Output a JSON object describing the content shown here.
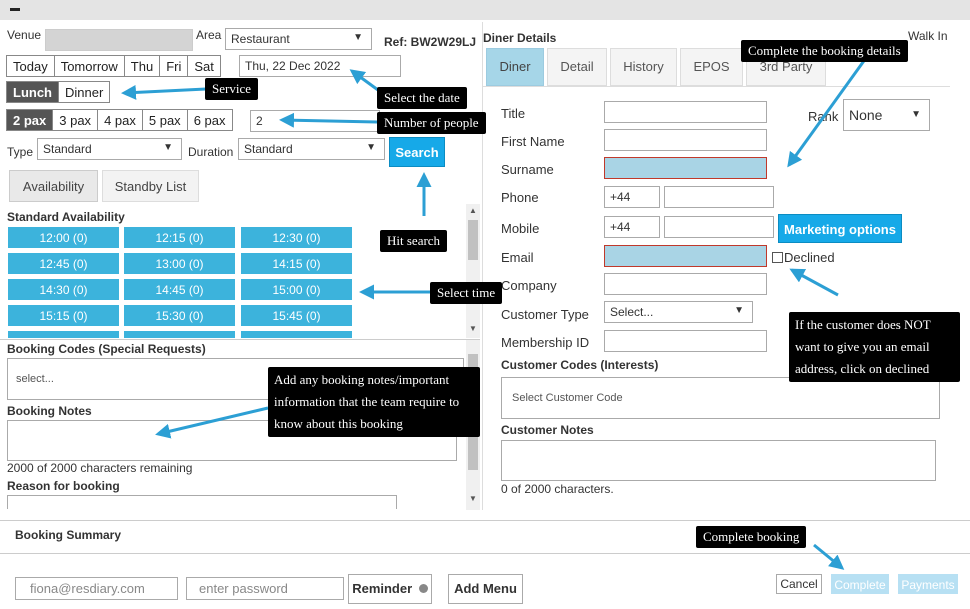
{
  "left": {
    "venue_label": "Venue",
    "area_label": "Area",
    "area_value": "Restaurant",
    "ref_label": "Ref: BW2W29LJ",
    "day_buttons": [
      "Today",
      "Tomorrow",
      "Thu",
      "Fri",
      "Sat"
    ],
    "date_value": "Thu, 22 Dec 2022",
    "service_buttons": [
      "Lunch",
      "Dinner"
    ],
    "pax_buttons": [
      "2 pax",
      "3 pax",
      "4 pax",
      "5 pax",
      "6 pax"
    ],
    "pax_value": "2",
    "type_label": "Type",
    "type_value": "Standard",
    "duration_label": "Duration",
    "duration_value": "Standard",
    "search_label": "Search",
    "tabs": [
      "Availability",
      "Standby List"
    ],
    "availability_title": "Standard Availability",
    "slots": [
      "12:00 (0)",
      "12:15 (0)",
      "12:30 (0)",
      "12:45 (0)",
      "13:00 (0)",
      "14:15 (0)",
      "14:30 (0)",
      "14:45 (0)",
      "15:00 (0)",
      "15:15 (0)",
      "15:30 (0)",
      "15:45 (0)"
    ],
    "booking_codes_title": "Booking Codes (Special Requests)",
    "booking_codes_placeholder": "select...",
    "booking_notes_title": "Booking Notes",
    "chars_remaining": "2000 of 2000 characters remaining",
    "reason_title": "Reason for booking"
  },
  "right": {
    "diner_details_title": "Diner Details",
    "walk_in": "Walk In",
    "tabs": [
      "Diner",
      "Detail",
      "History",
      "EPOS",
      "3rd Party"
    ],
    "title_label": "Title",
    "rank_label": "Rank",
    "rank_value": "None",
    "first_name_label": "First Name",
    "surname_label": "Surname",
    "phone_label": "Phone",
    "phone_code": "+44",
    "mobile_label": "Mobile",
    "mobile_code": "+44",
    "marketing_label": "Marketing options",
    "email_label": "Email",
    "declined_label": "Declined",
    "company_label": "Company",
    "customer_type_label": "Customer Type",
    "customer_type_value": "Select...",
    "membership_label": "Membership ID",
    "customer_codes_title": "Customer Codes (Interests)",
    "customer_code_placeholder": "Select Customer Code",
    "customer_notes_title": "Customer Notes",
    "customer_notes_chars": "0 of 2000 characters."
  },
  "summary": {
    "title": "Booking Summary",
    "email_placeholder": "fiona@resdiary.com",
    "password_placeholder": "enter password",
    "reminder_label": "Reminder",
    "add_menu_label": "Add Menu",
    "cancel_label": "Cancel",
    "complete_label": "Complete",
    "payments_label": "Payments"
  },
  "callouts": {
    "complete_details": "Complete the booking details",
    "service": "Service",
    "select_date": "Select the date",
    "number_people": "Number of people",
    "hit_search": "Hit search",
    "select_time": "Select time",
    "booking_notes": "Add any booking notes/important information that the team require to know about this booking",
    "declined_note": "If the customer does NOT want to give you an email address, click on declined",
    "complete_booking": "Complete booking"
  },
  "colors": {
    "accent": "#16a9e8",
    "slot": "#3cb3dc",
    "arrow": "#2c9fd4",
    "required_field": "#a9d4e5"
  }
}
